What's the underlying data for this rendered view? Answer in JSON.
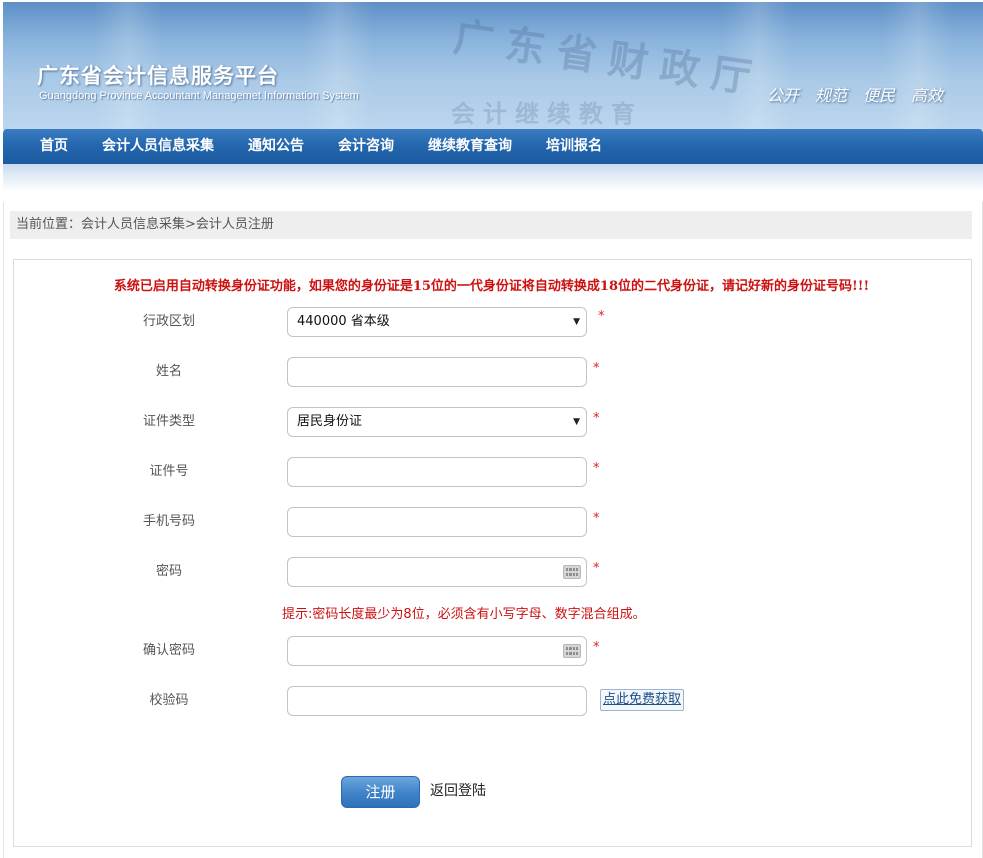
{
  "header": {
    "title": "广东省会计信息服务平台",
    "subtitle": "Guangdong Province Accountant Managemet Information System",
    "watermark_line1": "广东省财政厅",
    "watermark_line2": "会计继续教育",
    "slogans": [
      "公开",
      "规范",
      "便民",
      "高效"
    ]
  },
  "nav": {
    "items": [
      "首页",
      "会计人员信息采集",
      "通知公告",
      "会计咨询",
      "继续教育查询",
      "培训报名"
    ]
  },
  "breadcrumb": "当前位置：会计人员信息采集>会计人员注册",
  "form": {
    "notice": "系统已启用自动转换身份证功能，如果您的身份证是15位的一代身份证将自动转换成18位的二代身份证，请记好新的身份证号码!!!",
    "required_mark": "*",
    "region": {
      "label": "行政区划",
      "value": "440000 省本级"
    },
    "name": {
      "label": "姓名",
      "value": ""
    },
    "id_type": {
      "label": "证件类型",
      "value": "居民身份证"
    },
    "id_number": {
      "label": "证件号",
      "value": ""
    },
    "phone": {
      "label": "手机号码",
      "value": ""
    },
    "password": {
      "label": "密码",
      "value": ""
    },
    "password_hint": "提示:密码长度最少为8位，必须含有小写字母、数字混合组成。",
    "confirm_password": {
      "label": "确认密码",
      "value": ""
    },
    "captcha": {
      "label": "校验码",
      "value": "",
      "get_link": "点此免费获取"
    },
    "submit_label": "注册",
    "back_label": "返回登陆"
  },
  "colors": {
    "nav_blue": "#2366ad",
    "notice_red": "#cc1111",
    "button_blue": "#3f82c8"
  }
}
